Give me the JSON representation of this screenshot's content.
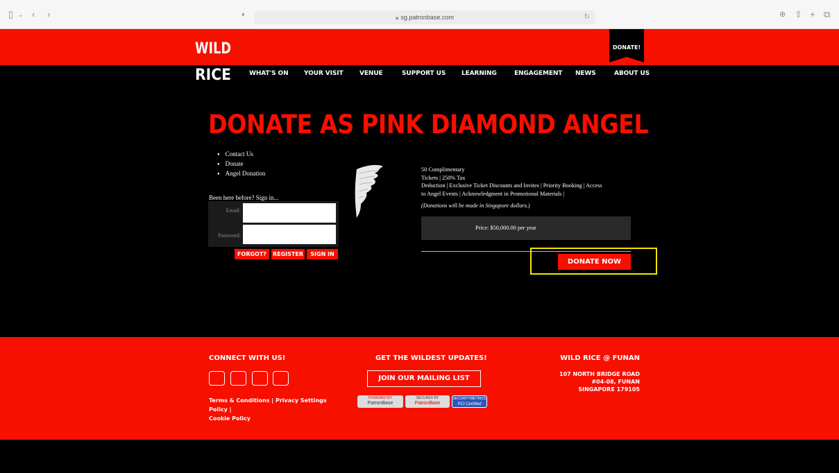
{
  "browser": {
    "url": "sg.patronbase.com"
  },
  "header": {
    "logo_lines": [
      "WILD",
      "RICE"
    ],
    "donate_label": "DONATE!",
    "nav": [
      "WHAT'S ON",
      "YOUR VISIT",
      "VENUE",
      "SUPPORT US",
      "LEARNING",
      "ENGAGEMENT",
      "NEWS",
      "ABOUT US"
    ]
  },
  "main": {
    "title": "DONATE AS PINK DIAMOND ANGEL",
    "breadcrumbs": [
      "Contact Us",
      "Donate",
      "Angel Donation"
    ],
    "signin": {
      "prompt": "Been here before? Sign in...",
      "email_label": "Email:",
      "password_label": "Password:",
      "forgot": "FORGOT?",
      "register": "REGISTER",
      "signin": "SIGN IN"
    },
    "benefits_lines": [
      "50 Complimentary",
      "Tickets | 250% Tax",
      "Deduction | Exclusive Ticket Discounts and Invites | Priority Booking | Access",
      "to Angel Events | Acknowledgment in Promotional Materials |"
    ],
    "note": "(Donations will be made in Singapore dollars.)",
    "price_label": "Price:",
    "price_value": "$50,000.00 per year",
    "donate_now": "DONATE NOW"
  },
  "footer": {
    "connect_title": "CONNECT WITH US!",
    "links_line1": "Terms & Conditions | Privacy Settings Policy |",
    "links_line2": "Cookie Policy",
    "updates_title": "GET THE WILDEST UPDATES!",
    "mailing_button": "JOIN OUR MAILING LIST",
    "badges": [
      {
        "top": "POWERED BY",
        "bottom": "PatronBase"
      },
      {
        "top": "SECURED BY",
        "bottom": "PatronBase"
      },
      {
        "top": "SECURITYMETRICS",
        "bottom": "PCI Certified"
      }
    ],
    "venue_title": "WILD RICE @ FUNAN",
    "address_lines": [
      "107 NORTH BRIDGE ROAD",
      "#04-08, FUNAN",
      "SINGAPORE 179105"
    ]
  },
  "colors": {
    "brand_red": "#f70f00",
    "highlight": "#f5e500"
  }
}
